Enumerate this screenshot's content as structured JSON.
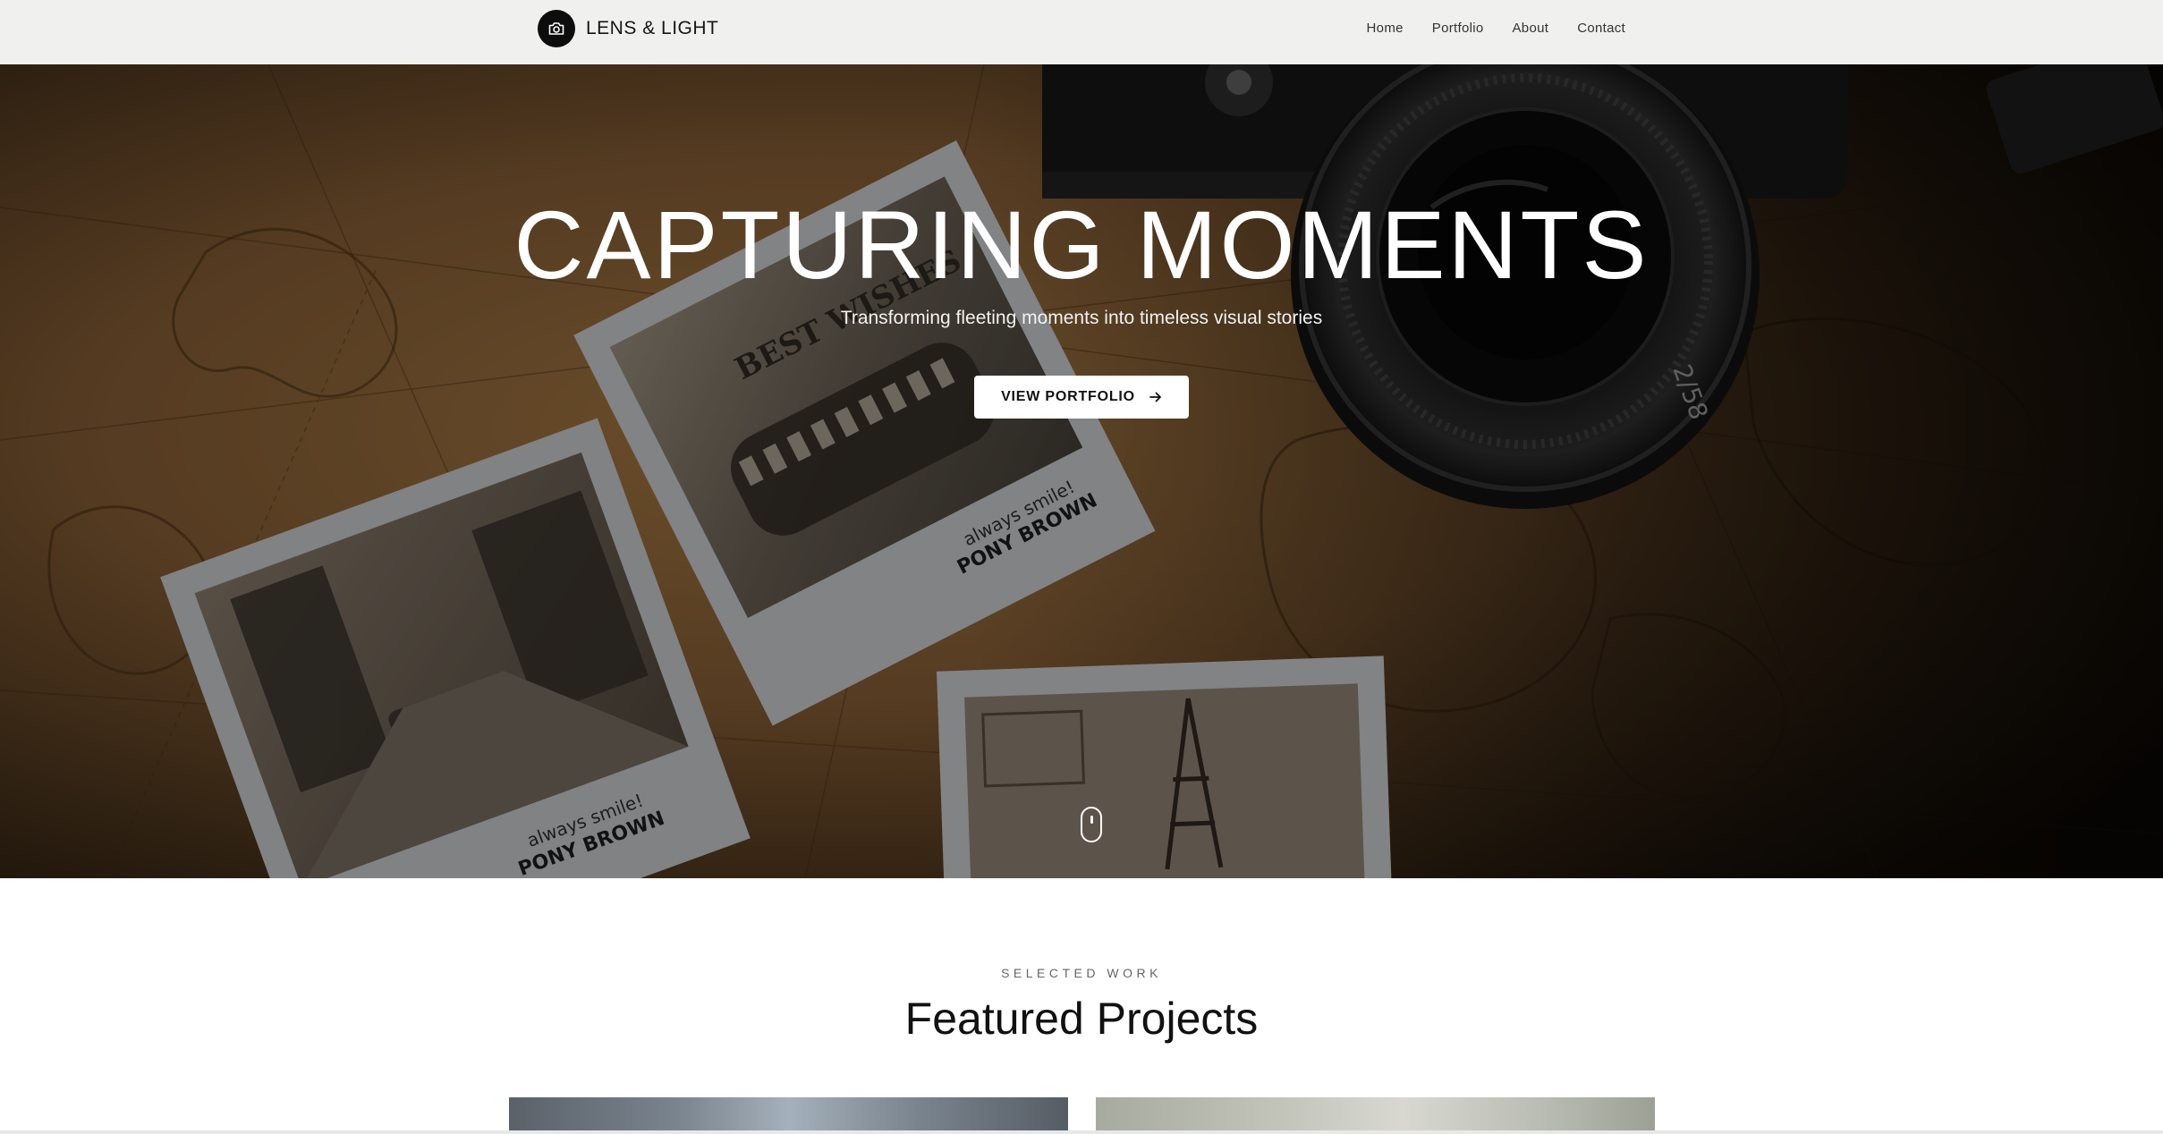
{
  "nav": {
    "brand": "LENS & LIGHT",
    "brand_icon": "camera-icon",
    "links": [
      "Home",
      "Portfolio",
      "About",
      "Contact"
    ]
  },
  "hero": {
    "title": "CAPTURING MOMENTS",
    "subtitle": "Transforming fleeting moments into timeless visual stories",
    "cta_label": "VIEW PORTFOLIO",
    "cta_icon": "arrow-right-icon",
    "scroll_icon": "mouse-scroll-icon",
    "photo_captions": {
      "card_top": [
        "BEST WISHES",
        "always smile!",
        "PONY BROWN"
      ],
      "card_left": [
        "always smile!",
        "PONY BROWN"
      ]
    }
  },
  "featured": {
    "eyebrow": "SELECTED WORK",
    "title": "Featured Projects"
  },
  "colors": {
    "nav_bg": "#f0efed",
    "hero_dark": "#2a1d10",
    "map_tan": "#8a6437",
    "cta_bg": "#ffffff",
    "text_dark": "#111111"
  }
}
